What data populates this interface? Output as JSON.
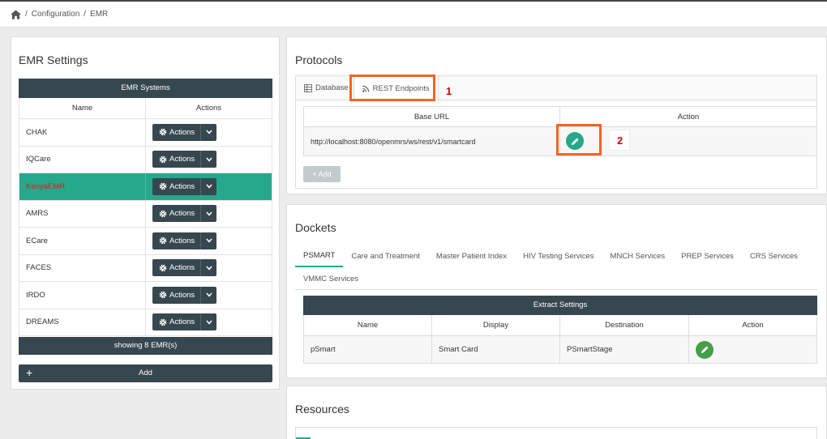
{
  "breadcrumb": {
    "sep": "/",
    "items": [
      "Configuration",
      "EMR"
    ]
  },
  "emr_settings": {
    "title": "EMR Settings",
    "table_title": "EMR Systems",
    "columns": [
      "Name",
      "Actions"
    ],
    "rows": [
      {
        "name": "CHAK",
        "action": "Actions"
      },
      {
        "name": "IQCare",
        "action": "Actions"
      },
      {
        "name": "KenyaEMR",
        "action": "Actions"
      },
      {
        "name": "AMRS",
        "action": "Actions"
      },
      {
        "name": "ECare",
        "action": "Actions"
      },
      {
        "name": "FACES",
        "action": "Actions"
      },
      {
        "name": "IRDO",
        "action": "Actions"
      },
      {
        "name": "DREAMS",
        "action": "Actions"
      }
    ],
    "footer": "showing 8 EMR(s)",
    "add_label": "Add",
    "add_plus": "+"
  },
  "protocols": {
    "title": "Protocols",
    "tabs": [
      "Database",
      "REST Endpoints"
    ],
    "columns": [
      "Base URL",
      "Action"
    ],
    "url": "http://localhost:8080/openmrs/ws/rest/v1/smartcard",
    "add_label": "+ Add",
    "annotation_1": "1",
    "annotation_2": "2"
  },
  "dockets": {
    "title": "Dockets",
    "tabs_row1": [
      "PSMART",
      "Care and Treatment",
      "Master Patient Index",
      "HIV Testing Services",
      "MNCH Services",
      "PREP Services",
      "CRS Services"
    ],
    "tabs_row2": [
      "VMMC Services"
    ],
    "table_title": "Extract Settings",
    "columns": [
      "Name",
      "Display",
      "Destination",
      "Action"
    ],
    "row": [
      "pSmart",
      "Smart Card",
      "PSmartStage"
    ]
  },
  "resources": {
    "title": "Resources"
  },
  "colors": {
    "accent": "#26a88a",
    "dark": "#37474f",
    "highlight": "#f26522",
    "label_red": "#d50000"
  }
}
